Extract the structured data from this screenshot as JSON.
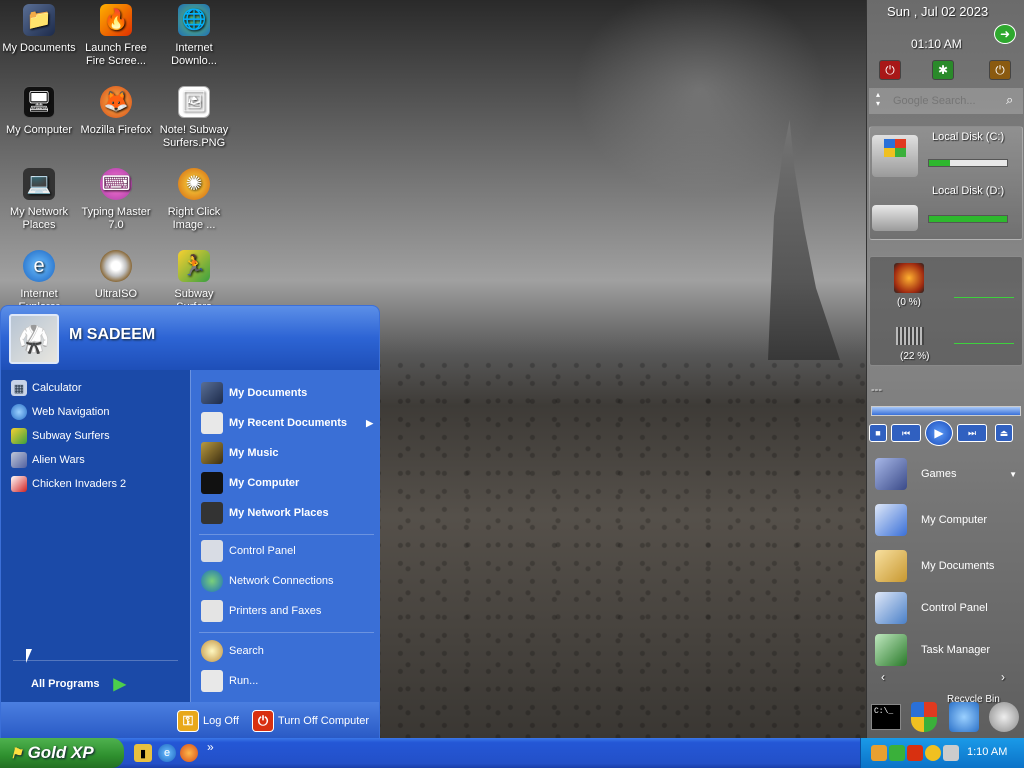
{
  "desktop": {
    "icons": [
      {
        "label": "My Documents"
      },
      {
        "label": "Launch Free\nFire Scree..."
      },
      {
        "label": "Internet\nDownlo..."
      },
      {
        "label": "My Computer"
      },
      {
        "label": "Mozilla Firefox"
      },
      {
        "label": "Note! Subway\nSurfers.PNG"
      },
      {
        "label": "My Network\nPlaces"
      },
      {
        "label": "Typing Master\n7.0"
      },
      {
        "label": "Right Click\nImage ..."
      },
      {
        "label": "Internet\nExplorer"
      },
      {
        "label": "UltraISO"
      },
      {
        "label": "Subway\nSurfers"
      }
    ]
  },
  "start_menu": {
    "username": "M SADEEM",
    "pinned": [
      "Calculator",
      "Web Navigation",
      "Subway Surfers",
      "Alien Wars",
      "Chicken Invaders 2"
    ],
    "all_programs": "All Programs",
    "right_bold": [
      "My Documents",
      "My Recent Documents",
      "My Music",
      "My Computer",
      "My Network Places"
    ],
    "right_normal": [
      "Control Panel",
      "Network Connections",
      "Printers and Faxes"
    ],
    "right_bottom": [
      "Search",
      "Run..."
    ],
    "log_off": "Log Off",
    "turn_off": "Turn Off Computer"
  },
  "sidebar": {
    "date": "Sun , Jul 02 2023",
    "time": "01:10 AM",
    "search_placeholder": "Google Search...",
    "disks": [
      {
        "label": "Local Disk (C:)",
        "fill": 0.27
      },
      {
        "label": "Local Disk (D:)",
        "fill": 1.0
      }
    ],
    "cpu": "(0 %)",
    "ram": "(22 %)",
    "player_text": "---",
    "launch": [
      "Games",
      "My Computer",
      "My Documents",
      "Control Panel",
      "Task Manager"
    ],
    "recycle": "Recycle Bin"
  },
  "taskbar": {
    "start_label": "Gold XP",
    "clock": "1:10 AM",
    "chevron": "»"
  }
}
